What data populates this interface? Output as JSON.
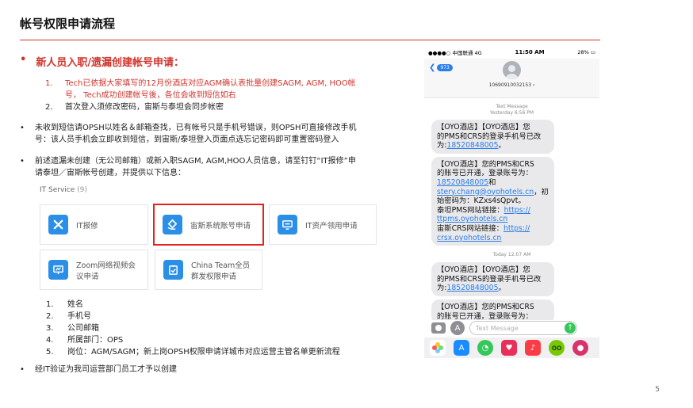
{
  "title": "帐号权限申请流程",
  "page_number": "5",
  "heading": {
    "bullet": "•",
    "text": "新人员入职/遗漏创建帐号申请："
  },
  "list1": [
    {
      "num": "1.",
      "line1": "Tech已依据大家填写的12月份酒店对应AGM确认表批量创建SAGM, AGM, HOO帐",
      "line2": "号， Tech成功创建帐号後，各位会收到短信如右"
    },
    {
      "num": "2.",
      "line1": "首次登入须修改密码，宙斯与泰坦会同步帐密",
      "line2": ""
    }
  ],
  "para1": {
    "bullet": "•",
    "line1": "未收到短信请OPSH以姓名＆邮箱查找，已有帐号只是手机号错误，则OPSH可直接修改手机",
    "line2": "号：该人员手机会立即收到短信，到宙斯/泰坦登入页面点选忘记密码即可重置密码登入"
  },
  "para2": {
    "bullet": "•",
    "line1": "前述遗漏未创建（无公司邮箱）或新入职SAGM, AGM,HOO人员信息，请至钉钉“IT报修”申",
    "line2": "请泰坦／宙斯帐号创建，并提供以下信息："
  },
  "it_service": {
    "label": "IT Service",
    "count": "(9)"
  },
  "tiles": [
    {
      "label": "IT报修",
      "icon": "tools-icon"
    },
    {
      "label": "宙斯系统账号申请",
      "icon": "diamond-hand-icon",
      "highlighted": true
    },
    {
      "label": "IT资产领用申请",
      "icon": "monitor-chat-icon"
    },
    {
      "label_line1": "Zoom网络视频会",
      "label_line2": "议申请",
      "icon": "presentation-icon"
    },
    {
      "label_line1": "China Team全员",
      "label_line2": "群发权限申请",
      "icon": "clipboard-check-icon"
    }
  ],
  "list2": [
    {
      "num": "1.",
      "text": "姓名"
    },
    {
      "num": "2.",
      "text": "手机号"
    },
    {
      "num": "3.",
      "text": "公司邮箱"
    },
    {
      "num": "4.",
      "text": "所属部门：OPS"
    },
    {
      "num": "5.",
      "text": "岗位：AGM/SAGM；新上岗OPSH权限申请详城市对应运营主管名单更新流程"
    }
  ],
  "para3": {
    "bullet": "•",
    "text": "经IT验证为我司运营部门员工才予以创建"
  },
  "phone": {
    "carrier": "中国联通",
    "network": "4G",
    "time": "11:50 AM",
    "battery": "28%",
    "back_badge": "973",
    "sender": "10690910032153",
    "meta1_line1": "Text Message",
    "meta1_line2": "Yesterday 6:56 PM",
    "bubble1": {
      "line1": "【OYO酒店】【OYO酒店】您",
      "line2": "的PMS和CRS的登录手机号已改",
      "line3_pre": "为:",
      "line3_link": "18520848005",
      "line3_post": "。"
    },
    "bubble2": {
      "line1": "【OYO酒店】您的PMS和CRS",
      "line2": "的账号已开通，登录账号为：",
      "link1": "18520848005",
      "line3_post": "和",
      "link2": "stery.chang@oyohotels.cn",
      "line4_post": "，初",
      "line5": "始密码为：KZxs4sQpvt。",
      "line6_pre": "泰坦PMS网站链接：",
      "link3": "https://",
      "link4": "ttpms.oyohotels.cn",
      "line8_pre": "宙斯CRS网站链接：",
      "link5": "https://",
      "link6": "crsx.oyohotels.cn"
    },
    "meta2": "Today 12:07 AM",
    "bubble3": {
      "line1": "【OYO酒店】【OYO酒店】您",
      "line2": "的PMS和CRS的登录手机号已改",
      "line3_pre": "为:",
      "line3_link": "18520848005",
      "line3_post": "。"
    },
    "bubble4": {
      "line1": "【OYO酒店】您的PMS和CRS",
      "line2": "的账号已开通，登录账号为："
    },
    "composer_placeholder": "Text Message"
  }
}
